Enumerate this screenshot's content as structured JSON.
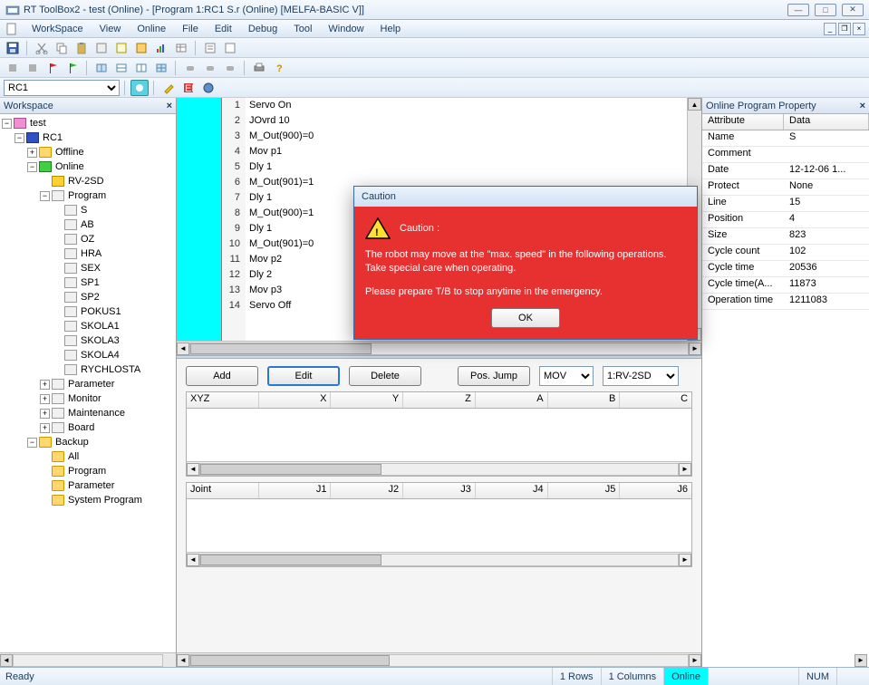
{
  "window": {
    "title": "RT ToolBox2 - test (Online) - [Program 1:RC1 S.r (Online)   [MELFA-BASIC V]]"
  },
  "menu": {
    "items": [
      "WorkSpace",
      "View",
      "Online",
      "File",
      "Edit",
      "Debug",
      "Tool",
      "Window",
      "Help"
    ]
  },
  "combo_robot": "RC1",
  "workspace": {
    "title": "Workspace",
    "tree": {
      "root": "test",
      "rc1": "RC1",
      "offline": "Offline",
      "online": "Online",
      "rv2sd": "RV-2SD",
      "program": "Program",
      "programs": [
        "S",
        "AB",
        "OZ",
        "HRA",
        "SEX",
        "SP1",
        "SP2",
        "POKUS1",
        "SKOLA1",
        "SKOLA3",
        "SKOLA4",
        "RYCHLOSTA"
      ],
      "parameter": "Parameter",
      "monitor": "Monitor",
      "maintenance": "Maintenance",
      "board": "Board",
      "backup": "Backup",
      "backup_items": [
        "All",
        "Program",
        "Parameter",
        "System Program"
      ]
    }
  },
  "code": {
    "lines": [
      "Servo On",
      "JOvrd 10",
      "M_Out(900)=0",
      "Mov p1",
      "Dly 1",
      "M_Out(901)=1",
      "Dly 1",
      "M_Out(900)=1",
      "Dly 1",
      "M_Out(901)=0",
      "Mov p2",
      "Dly 2",
      "Mov p3",
      "Servo Off"
    ],
    "line_count": 14
  },
  "pos_panel": {
    "add": "Add",
    "edit": "Edit",
    "delete": "Delete",
    "posjump": "Pos. Jump",
    "mov": "MOV",
    "robot": "1:RV-2SD",
    "xyz_cols": [
      "XYZ",
      "X",
      "Y",
      "Z",
      "A",
      "B",
      "C"
    ],
    "joint_cols": [
      "Joint",
      "J1",
      "J2",
      "J3",
      "J4",
      "J5",
      "J6"
    ]
  },
  "prop": {
    "title": "Online Program Property",
    "headers": {
      "attr": "Attribute",
      "data": "Data"
    },
    "rows": [
      {
        "attr": "Name",
        "data": "S"
      },
      {
        "attr": "Comment",
        "data": ""
      },
      {
        "attr": "Date",
        "data": "12-12-06 1..."
      },
      {
        "attr": "Protect",
        "data": "None"
      },
      {
        "attr": "Line",
        "data": "15"
      },
      {
        "attr": "Position",
        "data": "4"
      },
      {
        "attr": "Size",
        "data": "823"
      },
      {
        "attr": "Cycle count",
        "data": "102"
      },
      {
        "attr": "Cycle time",
        "data": "20536"
      },
      {
        "attr": "Cycle time(A...",
        "data": "11873"
      },
      {
        "attr": "Operation time",
        "data": "1211083"
      }
    ]
  },
  "status": {
    "ready": "Ready",
    "rows": "1 Rows",
    "cols": "1 Columns",
    "online": "Online",
    "num": "NUM"
  },
  "dialog": {
    "title": "Caution",
    "heading": "Caution :",
    "line1": "The robot may move at the \"max. speed\" in the following operations. Take special care when operating.",
    "line2": "Please prepare T/B to stop anytime in the emergency.",
    "ok": "OK"
  }
}
